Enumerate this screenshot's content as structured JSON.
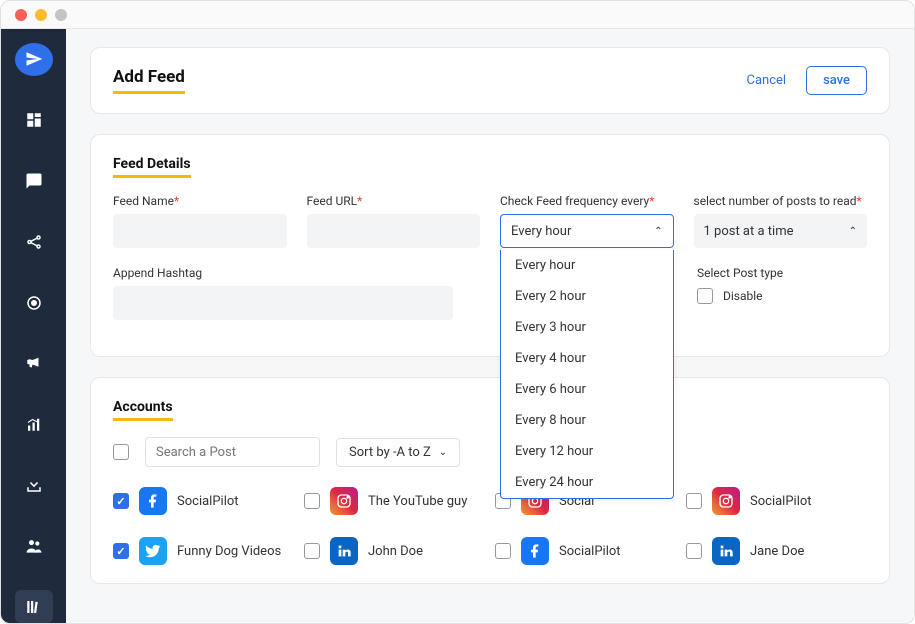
{
  "header": {
    "title": "Add Feed",
    "cancel": "Cancel",
    "save": "save"
  },
  "feedDetails": {
    "title": "Feed Details",
    "feedNameLabel": "Feed Name",
    "feedUrlLabel": "Feed URL",
    "frequencyLabel": "Check Feed frequency every",
    "frequencyValue": "Every hour",
    "postsLabel": "select number of posts to read",
    "postsValue": "1 post at a time",
    "hashtagLabel": "Append Hashtag",
    "postTypeLabel": "Select Post type",
    "disableLabel": "Disable",
    "freqOptions": [
      "Every hour",
      "Every 2 hour",
      "Every 3 hour",
      "Every 4 hour",
      "Every 6 hour",
      "Every 8 hour",
      "Every 12 hour",
      "Every 24 hour"
    ]
  },
  "accounts": {
    "title": "Accounts",
    "searchPlaceholder": "Search a Post",
    "sortLabel": "Sort by -A to Z",
    "items": [
      {
        "name": "SocialPilot",
        "net": "fb",
        "checked": true
      },
      {
        "name": "The YouTube guy",
        "net": "ig",
        "checked": false
      },
      {
        "name": "Social",
        "net": "ig",
        "checked": false
      },
      {
        "name": "SocialPilot",
        "net": "ig",
        "checked": false
      },
      {
        "name": "Funny Dog Videos",
        "net": "tw",
        "checked": true
      },
      {
        "name": "John Doe",
        "net": "li",
        "checked": false
      },
      {
        "name": "SocialPilot",
        "net": "fb",
        "checked": false
      },
      {
        "name": "Jane Doe",
        "net": "li",
        "checked": false
      }
    ]
  }
}
